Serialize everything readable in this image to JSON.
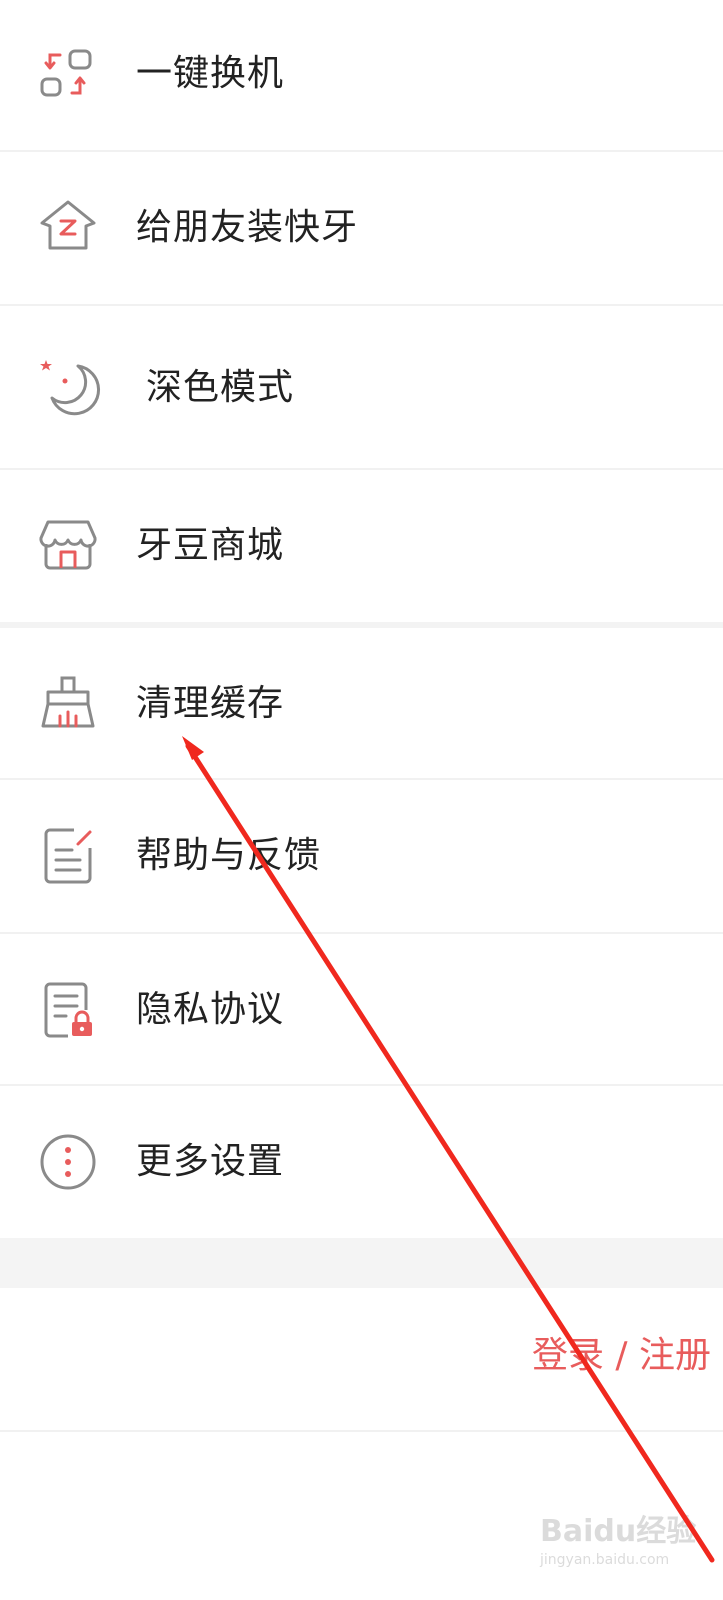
{
  "menu": {
    "items": [
      {
        "icon": "phone-switch-icon",
        "label": "一键换机"
      },
      {
        "icon": "house-share-icon",
        "label": "给朋友装快牙"
      },
      {
        "icon": "moon-icon",
        "label": "深色模式"
      },
      {
        "icon": "store-icon",
        "label": "牙豆商城"
      },
      {
        "icon": "broom-icon",
        "label": "清理缓存"
      },
      {
        "icon": "feedback-icon",
        "label": "帮助与反馈"
      },
      {
        "icon": "privacy-document-icon",
        "label": "隐私协议"
      },
      {
        "icon": "more-icon",
        "label": "更多设置"
      }
    ]
  },
  "account": {
    "login_label": "登录 / 注册"
  },
  "colors": {
    "accent": "#e85c5c",
    "icon_gray": "#8a8a8a",
    "text": "#222222",
    "divider": "#f1f1f1",
    "annotation_arrow": "#f0281e"
  },
  "watermark": {
    "brand": "Baidu经验",
    "url": "jingyan.baidu.com"
  }
}
